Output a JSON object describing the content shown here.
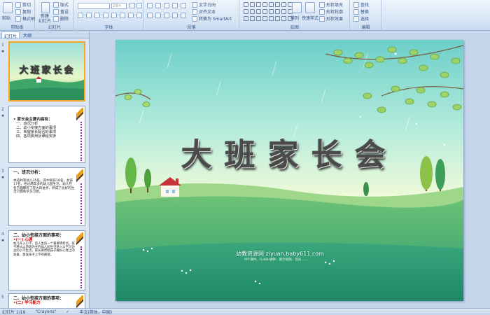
{
  "ribbon": {
    "groups": {
      "clipboard": "剪贴板",
      "slides": "幻灯片",
      "font": "字体",
      "paragraph": "段落",
      "drawing": "绘图",
      "editing": "编辑"
    },
    "clipboard": {
      "paste": "粘贴",
      "cut": "剪切",
      "copy": "复制",
      "format_painter": "格式刷"
    },
    "slides": {
      "new_slide": "新建",
      "new_slide2": "幻灯片",
      "layout": "版式",
      "reset": "重设",
      "delete": "删除"
    },
    "font": {
      "size": "28+"
    },
    "paragraph": {
      "text_direction": "文字方向",
      "align_text": "对齐文本",
      "smartart": "转换为 SmartArt"
    },
    "drawing": {
      "arrange": "排列",
      "quick_styles": "快速样式",
      "shape_fill": "形状填充",
      "shape_outline": "形状轮廓",
      "shape_effects": "形状效果"
    },
    "editing": {
      "find": "查找",
      "replace": "替换",
      "select": "选择"
    }
  },
  "left_pane": {
    "tabs": [
      "幻灯片",
      "大纲"
    ],
    "slides": [
      {
        "num": "1",
        "title": "大班家长会"
      },
      {
        "num": "2",
        "heading": "• 家长会主要内容有：",
        "items": [
          "一、班况分析",
          "二、幼小衔接方面的事项",
          "三、希望家长配合的事项",
          "四、各项费用及课程安排"
        ]
      },
      {
        "num": "3",
        "heading": "一、班况分析：",
        "body": "本班共有幼儿35名，其中男孩18名，女孩17名。经过两年多的幼儿园生活，幼儿在各方面都有了较大的进步，养成了良好的生活习惯和学习习惯。"
      },
      {
        "num": "4",
        "heading": "二、幼小衔接方面的事项：",
        "sub": "•(一) 心理",
        "body": "幼儿升入小学，是人生的一个重要转折点。孩子将从以游戏为主的幼儿园生活进入以学习为主的小学生活，家长要帮助孩子做好心理上的准备，激发孩子上学的愿望。"
      },
      {
        "num": "5",
        "heading": "二、幼小衔接方面的事项：",
        "sub": "•(二) 学习能力"
      }
    ]
  },
  "slide": {
    "title": "大班家长会",
    "watermark": "幼教资源网 ziyuan.baby611.com",
    "watermark_sub": "PPT课件、FLASH课件、教学视频、音乐……"
  },
  "status": {
    "slide_info": "幻灯片 1/19",
    "theme": "\"Crayons\"",
    "language": "中文(简体，中国)"
  }
}
